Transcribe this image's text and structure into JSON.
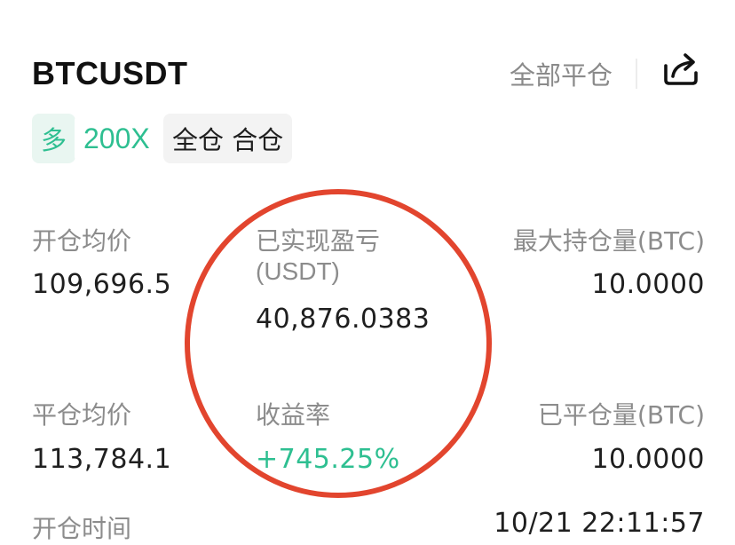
{
  "header": {
    "symbol": "BTCUSDT",
    "close_all_label": "全部平仓",
    "share_icon": "share-icon"
  },
  "tags": {
    "side": "多",
    "leverage": "200X",
    "margin_mode": "全仓 合仓"
  },
  "stats": {
    "open_avg_price_label": "开仓均价",
    "open_avg_price_value": "109,696.5",
    "realized_pnl_label": "已实现盈亏",
    "realized_pnl_unit": "(USDT)",
    "realized_pnl_value": "40,876.0383",
    "max_position_label": "最大持仓量(BTC)",
    "max_position_value": "10.0000",
    "close_avg_price_label": "平仓均价",
    "close_avg_price_value": "113,784.1",
    "roi_label": "收益率",
    "roi_value": "+745.25%",
    "closed_position_label": "已平仓量(BTC)",
    "closed_position_value": "10.0000",
    "open_time_label": "开仓时间",
    "open_time_value": "10/21 22:11:57"
  },
  "colors": {
    "positive": "#2ebf91",
    "muted_text": "#8c8c8c",
    "annotation_circle": "#e2452e"
  }
}
